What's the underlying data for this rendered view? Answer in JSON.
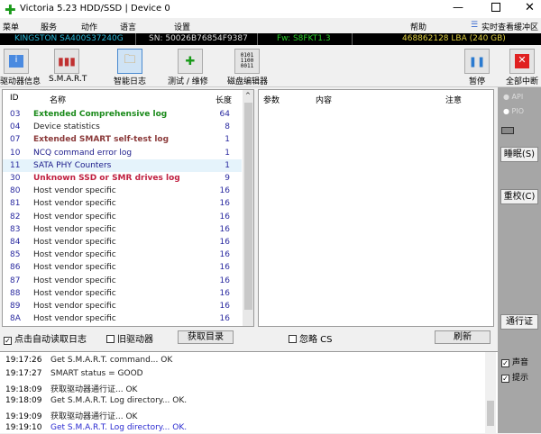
{
  "window": {
    "title": "Victoria 5.23 HDD/SSD | Device 0"
  },
  "menu": {
    "items": [
      "菜单",
      "服务",
      "动作",
      "语言",
      "设置",
      "帮助"
    ],
    "buffer": "实时查看缓冲区"
  },
  "device": {
    "model": "KINGSTON SA400S37240G",
    "sn": "SN: 50026B76854F9387",
    "fw": "Fw: S8FKT1.3",
    "lba": "468862128 LBA (240 GB)"
  },
  "toolbar": {
    "info": "驱动器信息",
    "smart": "S.M.A.R.T",
    "log": "智能日志",
    "test": "测试 / 维修",
    "editor": "磁盘编辑器",
    "pause": "暂停",
    "stop": "全部中断"
  },
  "list": {
    "headers": [
      "ID",
      "名称",
      "长度"
    ],
    "rows": [
      {
        "id": "03",
        "name": "Extended Comprehensive log",
        "len": "64",
        "color": "#1a8a1a"
      },
      {
        "id": "04",
        "name": "Device statistics",
        "len": "8",
        "color": "#222"
      },
      {
        "id": "07",
        "name": "Extended SMART self-test log",
        "len": "1",
        "color": "#8b3a3a"
      },
      {
        "id": "10",
        "name": "NCQ command error log",
        "len": "1",
        "color": "#1a1a8a"
      },
      {
        "id": "11",
        "name": "SATA PHY Counters",
        "len": "1",
        "color": "#1a1a8a"
      },
      {
        "id": "30",
        "name": "Unknown SSD or SMR drives log",
        "len": "9",
        "color": "#c02040"
      },
      {
        "id": "80",
        "name": "Host vendor specific",
        "len": "16",
        "color": "#222"
      },
      {
        "id": "81",
        "name": "Host vendor specific",
        "len": "16",
        "color": "#222"
      },
      {
        "id": "82",
        "name": "Host vendor specific",
        "len": "16",
        "color": "#222"
      },
      {
        "id": "83",
        "name": "Host vendor specific",
        "len": "16",
        "color": "#222"
      },
      {
        "id": "84",
        "name": "Host vendor specific",
        "len": "16",
        "color": "#222"
      },
      {
        "id": "85",
        "name": "Host vendor specific",
        "len": "16",
        "color": "#222"
      },
      {
        "id": "86",
        "name": "Host vendor specific",
        "len": "16",
        "color": "#222"
      },
      {
        "id": "87",
        "name": "Host vendor specific",
        "len": "16",
        "color": "#222"
      },
      {
        "id": "88",
        "name": "Host vendor specific",
        "len": "16",
        "color": "#222"
      },
      {
        "id": "89",
        "name": "Host vendor specific",
        "len": "16",
        "color": "#222"
      },
      {
        "id": "8A",
        "name": "Host vendor specific",
        "len": "16",
        "color": "#222"
      }
    ]
  },
  "detail": {
    "headers": [
      "参数",
      "内容",
      "注意"
    ]
  },
  "side": {
    "api": "API",
    "pio": "PIO",
    "sleep": "睡眠(S)",
    "recal": "重校(C)",
    "passport": "通行证",
    "sound": "声音",
    "hints": "提示"
  },
  "controls": {
    "auto_read": "点击自动读取日志",
    "old_driver": "旧驱动器",
    "get_dir": "获取目录",
    "ignore_cs": "忽略 CS",
    "refresh": "刷新"
  },
  "log": [
    {
      "time": "19:17:26",
      "msg": "Get S.M.A.R.T. command... OK",
      "color": "#222"
    },
    {
      "time": "19:17:27",
      "msg": "SMART status = GOOD",
      "color": "#222"
    },
    {
      "time": "19:18:09",
      "msg": "获取驱动器通行证... OK",
      "color": "#222"
    },
    {
      "time": "19:18:09",
      "msg": "Get S.M.A.R.T. Log directory... OK.",
      "color": "#222"
    },
    {
      "time": "19:19:09",
      "msg": "获取驱动器通行证... OK",
      "color": "#222"
    },
    {
      "time": "19:19:10",
      "msg": "Get S.M.A.R.T. Log directory... OK.",
      "color": "#2a2ad0"
    }
  ]
}
